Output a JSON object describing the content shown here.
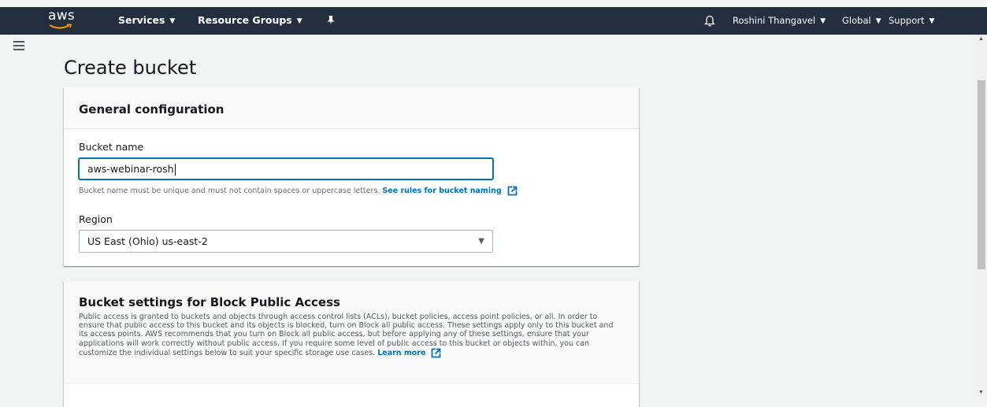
{
  "nav": {
    "logo": "aws",
    "services": "Services",
    "resource_groups": "Resource Groups",
    "pin_icon": "pin-icon",
    "bell_icon": "bell-icon",
    "user": "Roshini Thangavel",
    "region": "Global",
    "support": "Support"
  },
  "page": {
    "title": "Create bucket"
  },
  "general": {
    "title": "General configuration",
    "bucket_name_label": "Bucket name",
    "bucket_name_value": "aws-webinar-rosh",
    "hint": "Bucket name must be unique and must not contain spaces or uppercase letters.",
    "hint_link": "See rules for bucket naming",
    "region_label": "Region",
    "region_value": "US East (Ohio) us-east-2"
  },
  "block_access": {
    "title": "Bucket settings for Block Public Access",
    "description": "Public access is granted to buckets and objects through access control lists (ACLs), bucket policies, access point policies, or all. In order to ensure that public access to this bucket and its objects is blocked, turn on Block all public access. These settings apply only to this bucket and its access points. AWS recommends that you turn on Block all public access, but before applying any of these settings, ensure that your applications will work correctly without public access. If you require some level of public access to this bucket or objects within, you can customize the individual settings below to suit your specific storage use cases.",
    "learn_more": "Learn more"
  },
  "colors": {
    "nav_bg": "#232f3e",
    "link": "#0073bb",
    "page_bg": "#f2f3f3"
  }
}
